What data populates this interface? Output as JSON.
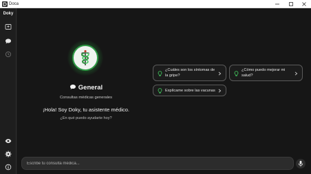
{
  "window": {
    "title": "Doca",
    "controls": [
      "minimize-icon",
      "maximize-icon",
      "close-icon"
    ]
  },
  "sidebar": {
    "brand": "Doky",
    "top_items": [
      {
        "icon": "new-chat-icon"
      },
      {
        "icon": "chat-bubble-icon"
      },
      {
        "icon": "history-icon"
      }
    ],
    "bottom_items": [
      {
        "icon": "eye-icon"
      },
      {
        "icon": "gear-icon"
      },
      {
        "icon": "info-icon"
      }
    ]
  },
  "mode": {
    "title": "General",
    "subtitle": "Consultas médicas generales"
  },
  "greeting": {
    "headline": "¡Hola! Soy Doky, tu asistente médico.",
    "question": "¿En qué puedo ayudarte hoy?"
  },
  "suggestions": [
    {
      "line1": "¿Cuáles son los síntomas de",
      "line2": "la gripe?"
    },
    {
      "line1": "¿Cómo puedo mejorar mi",
      "line2": "salud?"
    },
    {
      "line1": "Explícame sobre las vacunas",
      "line2": ""
    }
  ],
  "input": {
    "placeholder": "Escribe tu consulta médica...",
    "value": ""
  },
  "colors": {
    "accent_green": "#3fbf5a",
    "background": "#161616",
    "sidebar": "#1e1e1e"
  }
}
